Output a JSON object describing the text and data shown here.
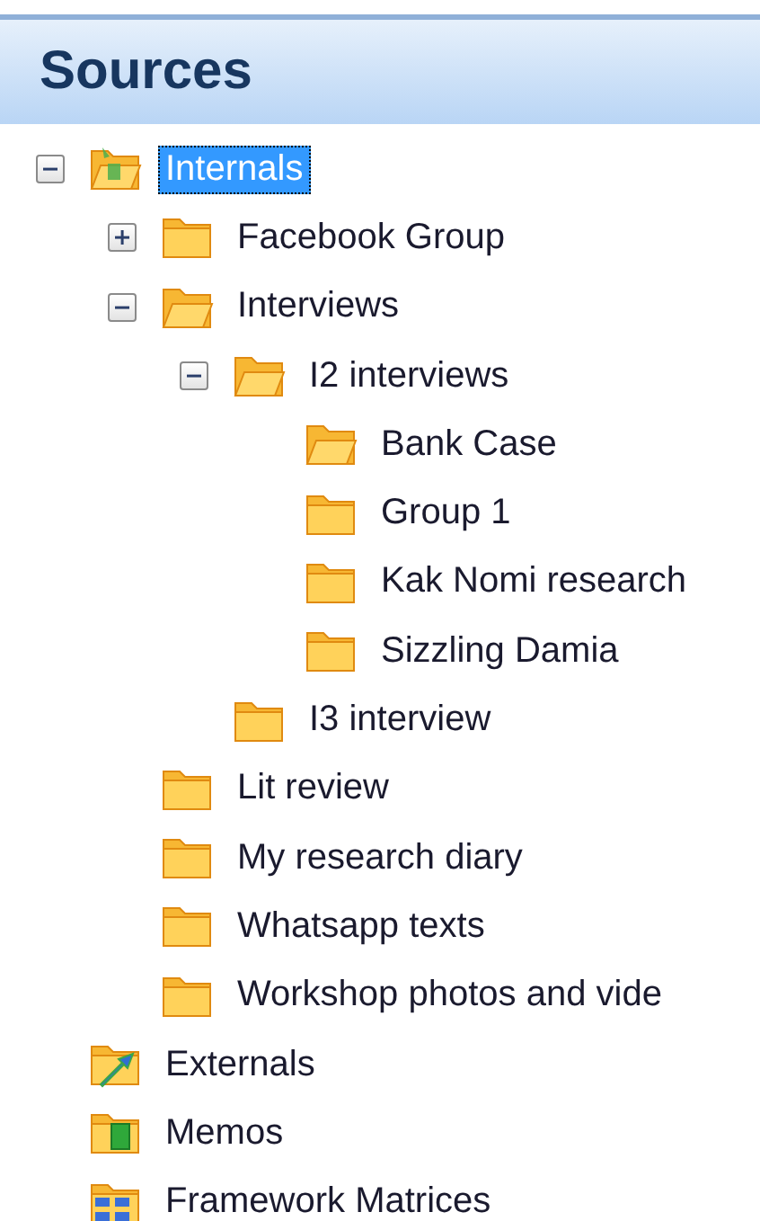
{
  "panel": {
    "title": "Sources"
  },
  "tree": [
    {
      "label": "Internals",
      "kind": "internals",
      "expanded": true,
      "selected": true,
      "children": [
        {
          "label": "Facebook Group",
          "kind": "folder",
          "expanded": false,
          "selected": false
        },
        {
          "label": "Interviews",
          "kind": "open",
          "expanded": true,
          "selected": false,
          "children": [
            {
              "label": "I2 interviews",
              "kind": "open",
              "expanded": true,
              "selected": false,
              "children": [
                {
                  "label": "Bank Case",
                  "kind": "open",
                  "selected": false
                },
                {
                  "label": "Group 1",
                  "kind": "folder",
                  "selected": false
                },
                {
                  "label": "Kak Nomi research",
                  "kind": "folder",
                  "selected": false
                },
                {
                  "label": "Sizzling Damia",
                  "kind": "folder",
                  "selected": false
                }
              ]
            },
            {
              "label": "I3 interview",
              "kind": "folder",
              "selected": false
            }
          ]
        },
        {
          "label": "Lit review",
          "kind": "folder",
          "selected": false
        },
        {
          "label": "My research diary",
          "kind": "folder",
          "selected": false
        },
        {
          "label": "Whatsapp texts",
          "kind": "folder",
          "selected": false
        },
        {
          "label": "Workshop photos and vide",
          "kind": "folder",
          "selected": false
        }
      ]
    },
    {
      "label": "Externals",
      "kind": "externals",
      "selected": false
    },
    {
      "label": "Memos",
      "kind": "memos",
      "selected": false
    },
    {
      "label": "Framework Matrices",
      "kind": "matrices",
      "selected": false
    }
  ]
}
